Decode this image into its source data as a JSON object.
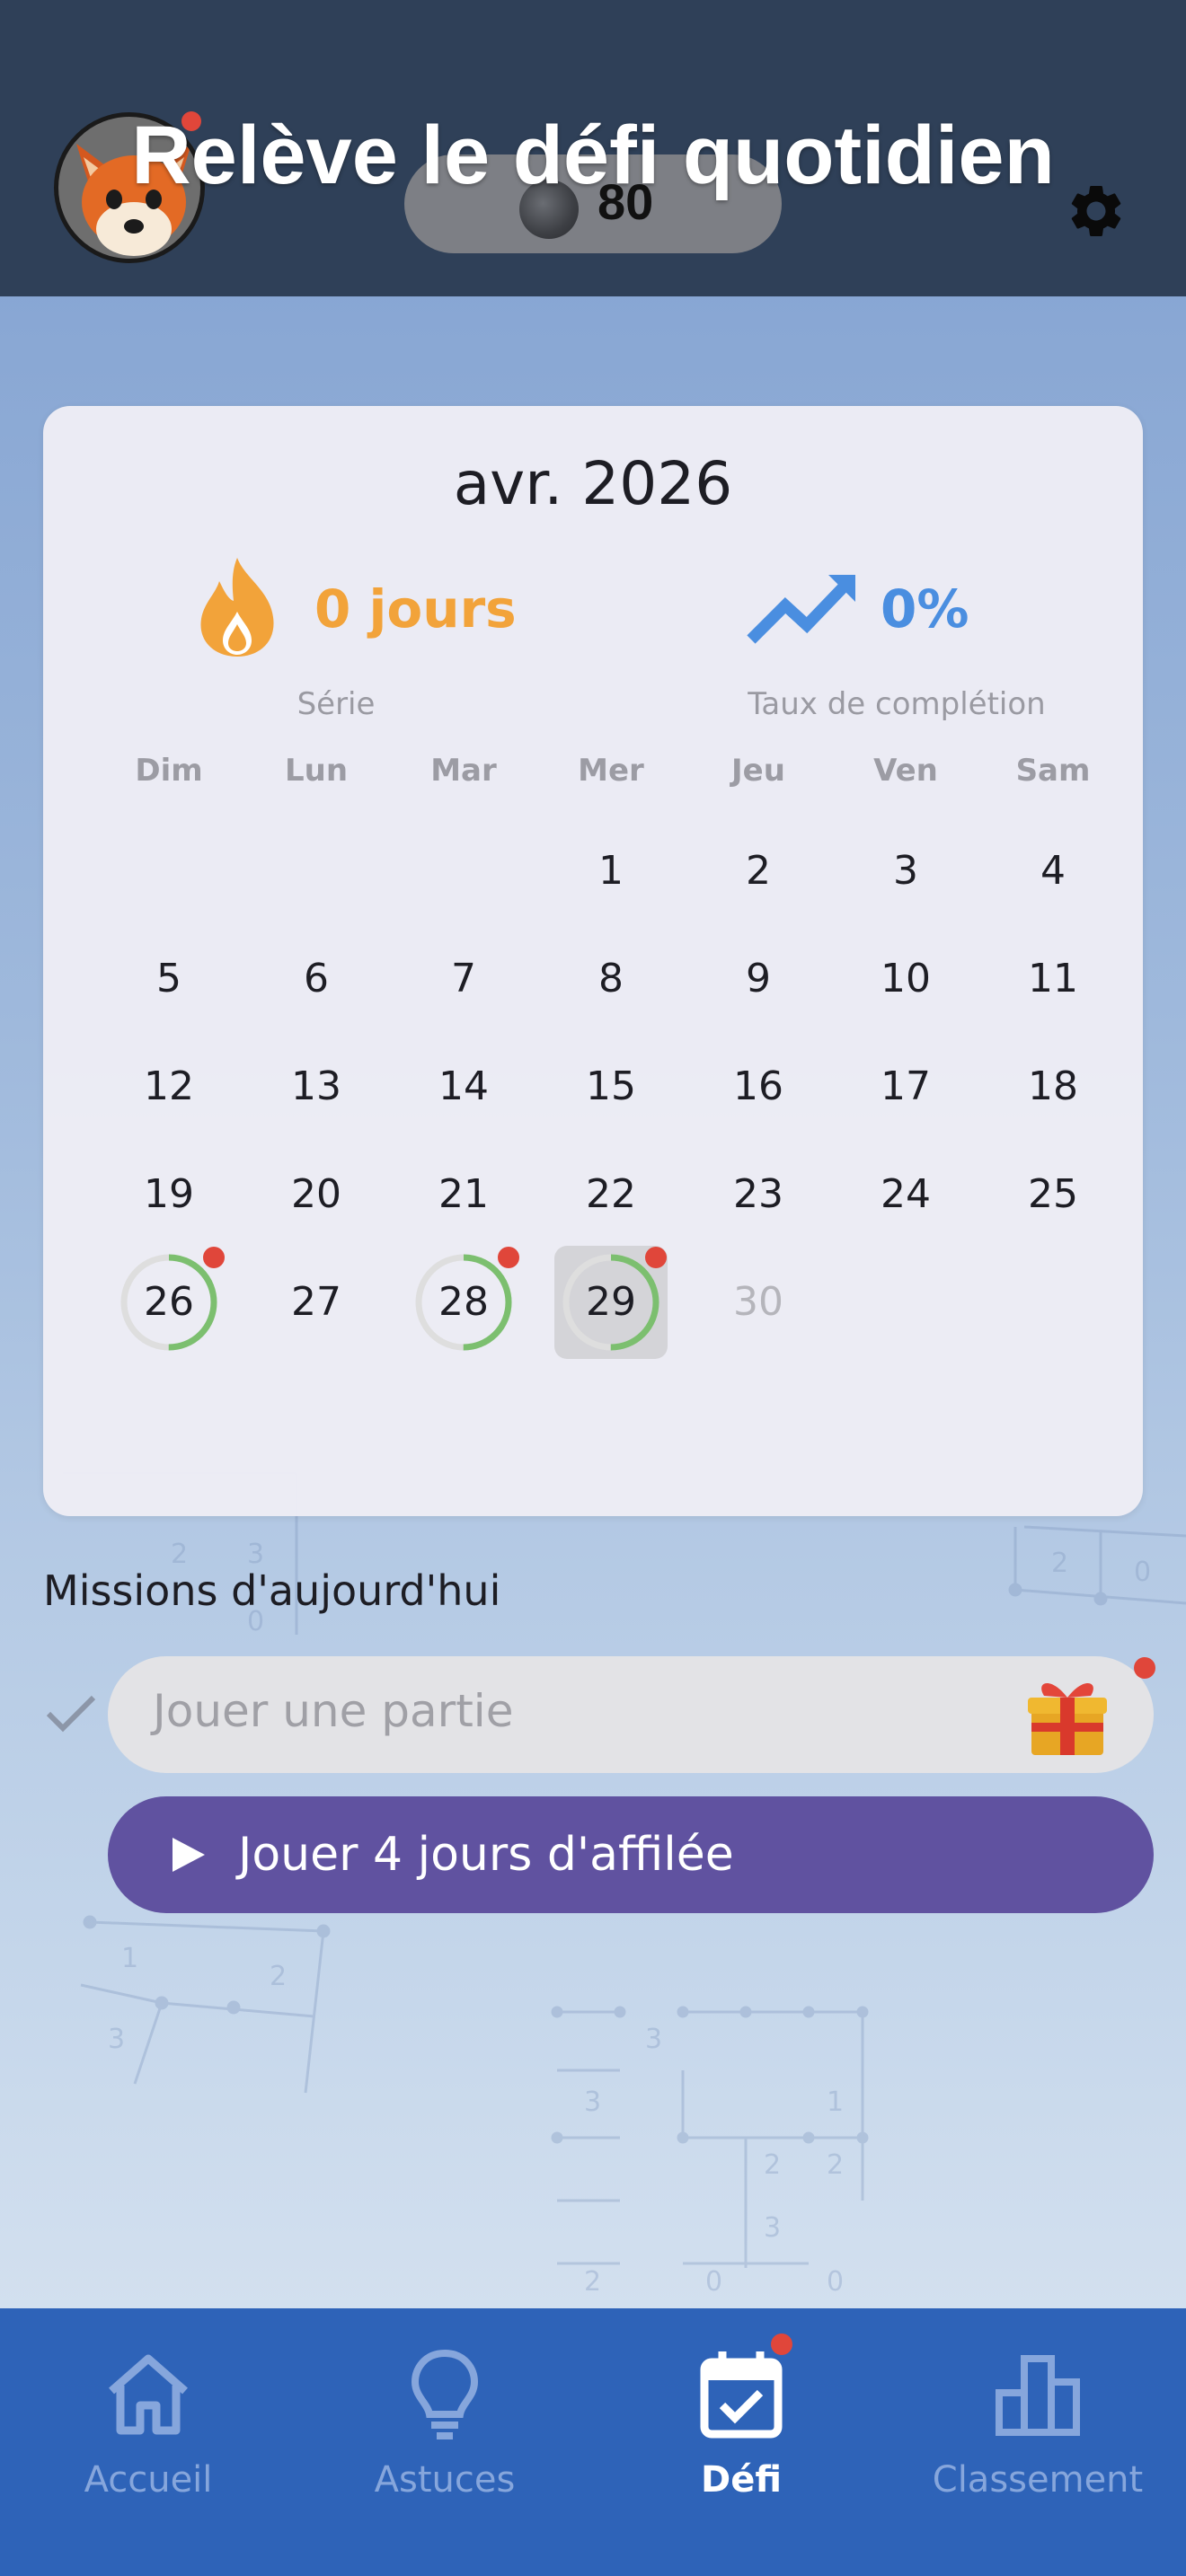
{
  "header": {
    "title": "Relève le défi quotidien",
    "coins": "80"
  },
  "calendar": {
    "month_label": "avr. 2026",
    "streak_value": "0 jours",
    "streak_label": "Série",
    "completion_value": "0%",
    "completion_label": "Taux de complétion",
    "weekdays": [
      "Dim",
      "Lun",
      "Mar",
      "Mer",
      "Jeu",
      "Ven",
      "Sam"
    ],
    "weeks": [
      [
        "",
        "",
        "",
        "1",
        "2",
        "3",
        "4"
      ],
      [
        "5",
        "6",
        "7",
        "8",
        "9",
        "10",
        "11"
      ],
      [
        "12",
        "13",
        "14",
        "15",
        "16",
        "17",
        "18"
      ],
      [
        "19",
        "20",
        "21",
        "22",
        "23",
        "24",
        "25"
      ],
      [
        "26",
        "27",
        "28",
        "29",
        "30",
        "",
        ""
      ]
    ],
    "today": "29",
    "played_days": [
      "26",
      "28",
      "29"
    ],
    "played_progress": 0.5,
    "future_days": [
      "30"
    ]
  },
  "missions": {
    "title": "Missions d'aujourd'hui",
    "items": [
      {
        "label": "Jouer une partie",
        "done": true,
        "reward_icon": "gift-icon"
      }
    ],
    "play_button": "Jouer 4 jours d'affilée"
  },
  "nav": {
    "items": [
      {
        "label": "Accueil",
        "icon": "home-icon",
        "active": false
      },
      {
        "label": "Astuces",
        "icon": "lightbulb-icon",
        "active": false
      },
      {
        "label": "Défi",
        "icon": "calendar-check-icon",
        "active": true
      },
      {
        "label": "Classement",
        "icon": "bar-chart-icon",
        "active": false
      }
    ]
  },
  "colors": {
    "header_bg": "#2f4058",
    "streak": "#f2a33a",
    "completion": "#4a8ee0",
    "ring": "#7cbf6f",
    "play_button": "#6052a0",
    "nav_bg": "#2e63b8",
    "badge": "#e0463a"
  }
}
